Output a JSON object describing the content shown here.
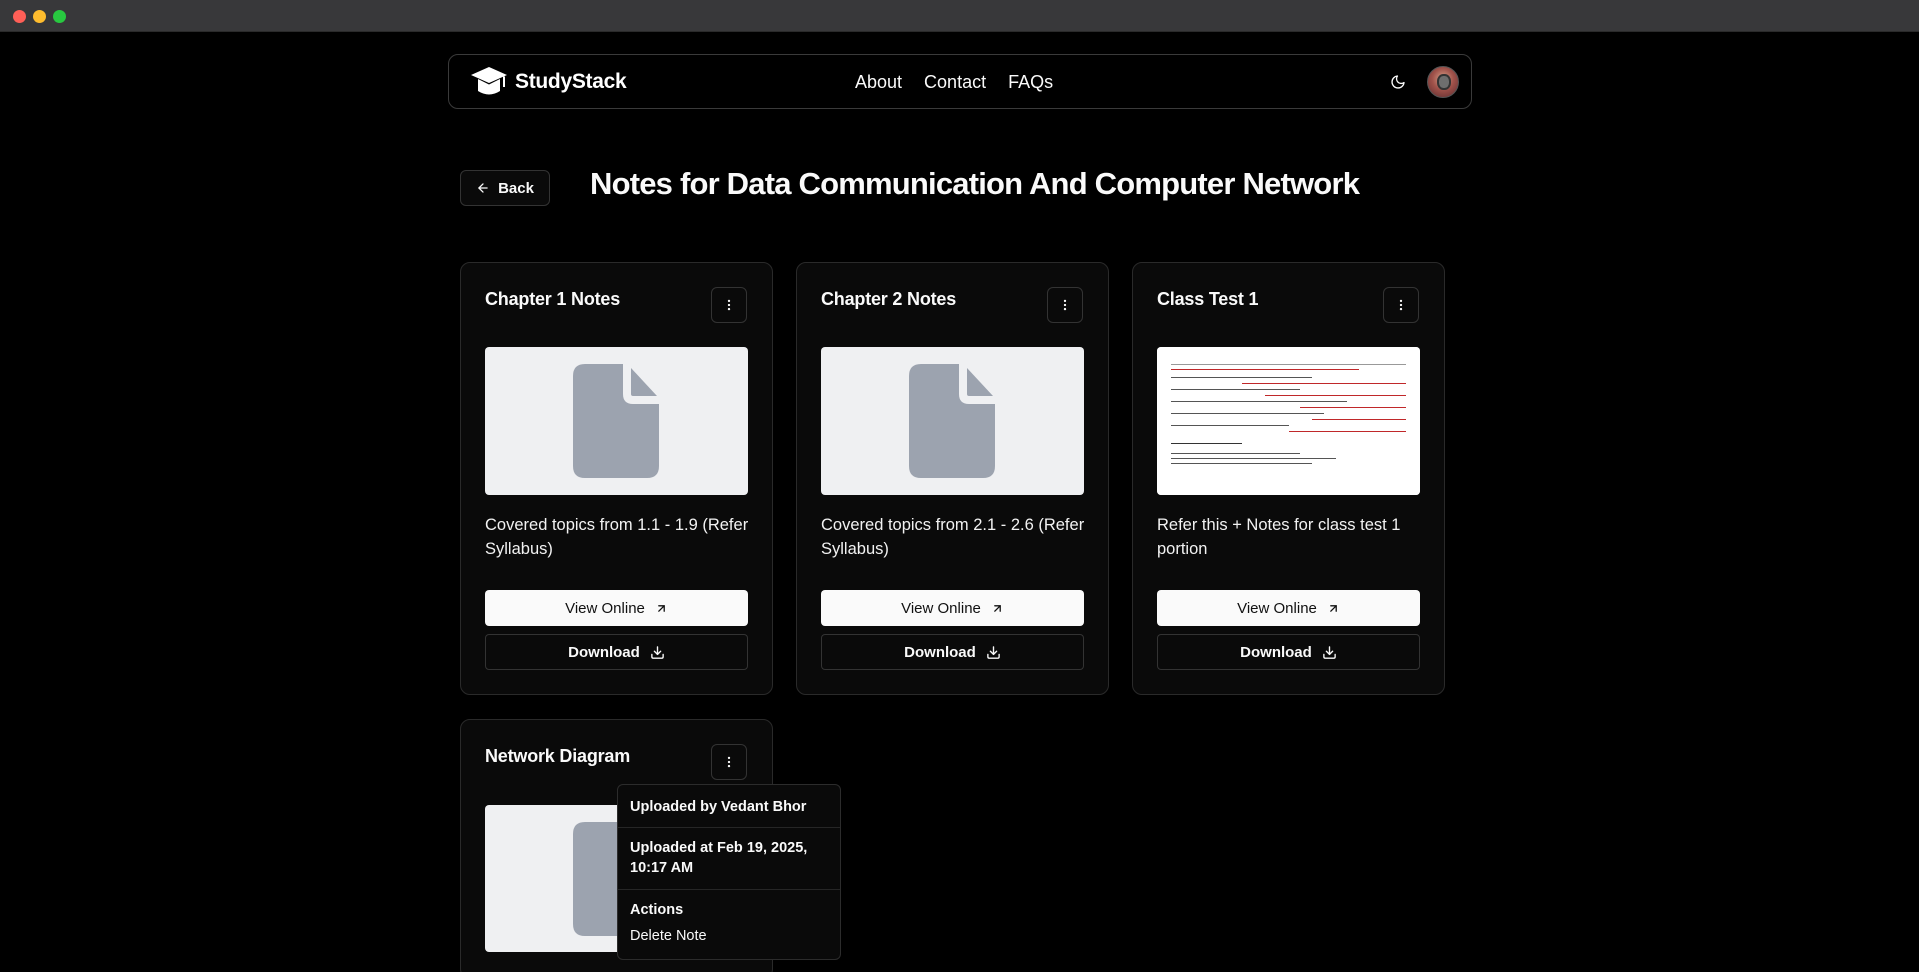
{
  "navbar": {
    "brand": "StudyStack",
    "links": [
      "About",
      "Contact",
      "FAQs"
    ]
  },
  "page": {
    "back_label": "Back",
    "title": "Notes for Data Communication And Computer Network"
  },
  "cards": [
    {
      "title": "Chapter 1 Notes",
      "description": "Covered topics from 1.1 - 1.9 (Refer Syllabus)",
      "view_label": "View Online",
      "download_label": "Download"
    },
    {
      "title": "Chapter 2 Notes",
      "description": "Covered topics from 2.1 - 2.6 (Refer Syllabus)",
      "view_label": "View Online",
      "download_label": "Download"
    },
    {
      "title": "Class Test 1",
      "description": "Refer this + Notes for class test 1 portion",
      "view_label": "View Online",
      "download_label": "Download"
    },
    {
      "title": "Network Diagram"
    }
  ],
  "popover": {
    "uploaded_by": "Uploaded by Vedant Bhor",
    "uploaded_at": "Uploaded at Feb 19, 2025, 10:17 AM",
    "actions_heading": "Actions",
    "delete_label": "Delete Note"
  },
  "colors": {
    "background": "#000000",
    "card_background": "#0a0a0a",
    "thumbnail_background": "#eff0f2",
    "file_icon": "#9ca3af",
    "primary_button": "#fafafa"
  },
  "icons": {
    "back": "arrow-left-icon",
    "menu": "more-vertical-icon",
    "view": "arrow-up-right-icon",
    "download": "download-icon",
    "theme": "moon-icon",
    "file": "file-icon"
  }
}
